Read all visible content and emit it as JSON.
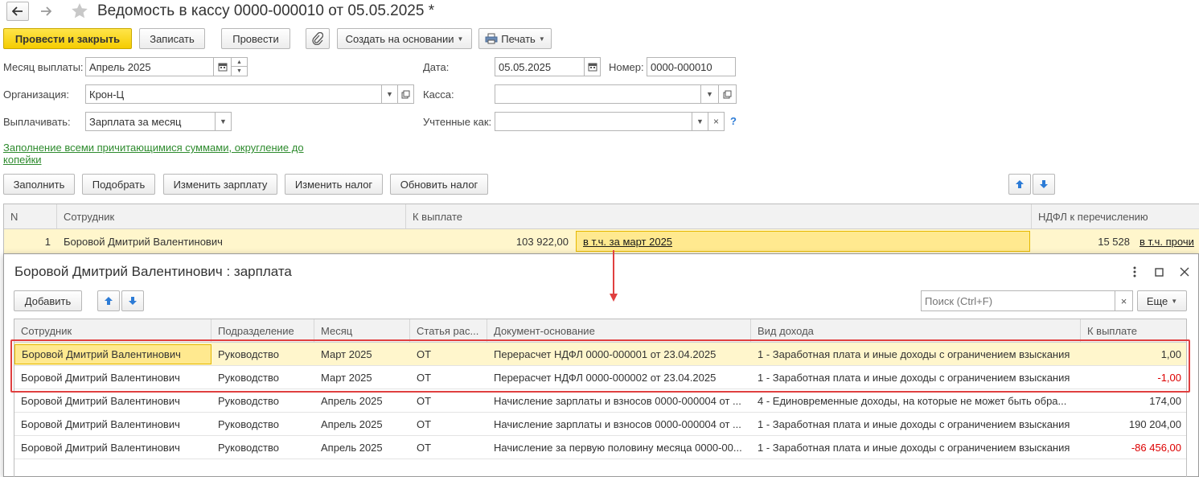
{
  "header": {
    "title": "Ведомость в кассу 0000-000010 от 05.05.2025 *"
  },
  "toolbar": {
    "post_close": "Провести и закрыть",
    "save": "Записать",
    "post": "Провести",
    "create_based": "Создать на основании",
    "print": "Печать"
  },
  "form": {
    "month_label": "Месяц выплаты:",
    "month_value": "Апрель 2025",
    "date_label": "Дата:",
    "date_value": "05.05.2025",
    "number_label": "Номер:",
    "number_value": "0000-000010",
    "org_label": "Организация:",
    "org_value": "Крон-Ц",
    "cash_label": "Касса:",
    "cash_value": "",
    "pay_label": "Выплачивать:",
    "pay_value": "Зарплата за месяц",
    "accounted_label": "Учтенные как:",
    "accounted_value": "",
    "help": "?",
    "fill_link": "Заполнение всеми причитающимися суммами, округление до копейки"
  },
  "table_toolbar": {
    "fill": "Заполнить",
    "pick": "Подобрать",
    "change_salary": "Изменить зарплату",
    "change_tax": "Изменить налог",
    "update_tax": "Обновить налог"
  },
  "main_table": {
    "columns": [
      "N",
      "Сотрудник",
      "К выплате",
      "НДФЛ к перечислению"
    ],
    "rows": [
      {
        "n": "1",
        "employee": "Боровой Дмитрий Валентинович",
        "amount": "103 922,00",
        "amount_link": "в т.ч. за март 2025",
        "tax": "15 528",
        "tax_link": "в т.ч. прочи"
      }
    ]
  },
  "popup": {
    "title": "Боровой Дмитрий Валентинович : зарплата",
    "add": "Добавить",
    "search_placeholder": "Поиск (Ctrl+F)",
    "more": "Еще",
    "columns": [
      "Сотрудник",
      "Подразделение",
      "Месяц",
      "Статья рас...",
      "Документ-основание",
      "Вид дохода",
      "К выплате"
    ],
    "rows": [
      {
        "employee": "Боровой Дмитрий Валентинович",
        "dept": "Руководство",
        "month": "Март 2025",
        "article": "ОТ",
        "doc": "Перерасчет НДФЛ 0000-000001 от 23.04.2025",
        "income": "1 - Заработная плата и иные доходы с ограничением взыскания",
        "amount": "1,00"
      },
      {
        "employee": "Боровой Дмитрий Валентинович",
        "dept": "Руководство",
        "month": "Март 2025",
        "article": "ОТ",
        "doc": "Перерасчет НДФЛ 0000-000002 от 23.04.2025",
        "income": "1 - Заработная плата и иные доходы с ограничением взыскания",
        "amount": "-1,00"
      },
      {
        "employee": "Боровой Дмитрий Валентинович",
        "dept": "Руководство",
        "month": "Апрель 2025",
        "article": "ОТ",
        "doc": "Начисление зарплаты и взносов 0000-000004 от ...",
        "income": "4 - Единовременные доходы, на которые не может быть обра...",
        "amount": "174,00"
      },
      {
        "employee": "Боровой Дмитрий Валентинович",
        "dept": "Руководство",
        "month": "Апрель 2025",
        "article": "ОТ",
        "doc": "Начисление зарплаты и взносов 0000-000004 от ...",
        "income": "1 - Заработная плата и иные доходы с ограничением взыскания",
        "amount": "190 204,00"
      },
      {
        "employee": "Боровой Дмитрий Валентинович",
        "dept": "Руководство",
        "month": "Апрель 2025",
        "article": "ОТ",
        "doc": "Начисление за первую половину месяца 0000-00...",
        "income": "1 - Заработная плата и иные доходы с ограничением взыскания",
        "amount": "-86 456,00"
      }
    ]
  },
  "colors": {
    "primary": "#f5cc00",
    "highlight": "#ffe98f",
    "selected_row": "#fff6cc",
    "negative": "#dd0000",
    "annotation": "#e04040",
    "link_green": "#2e8b2e",
    "nav_blue": "#2c7bd6"
  }
}
